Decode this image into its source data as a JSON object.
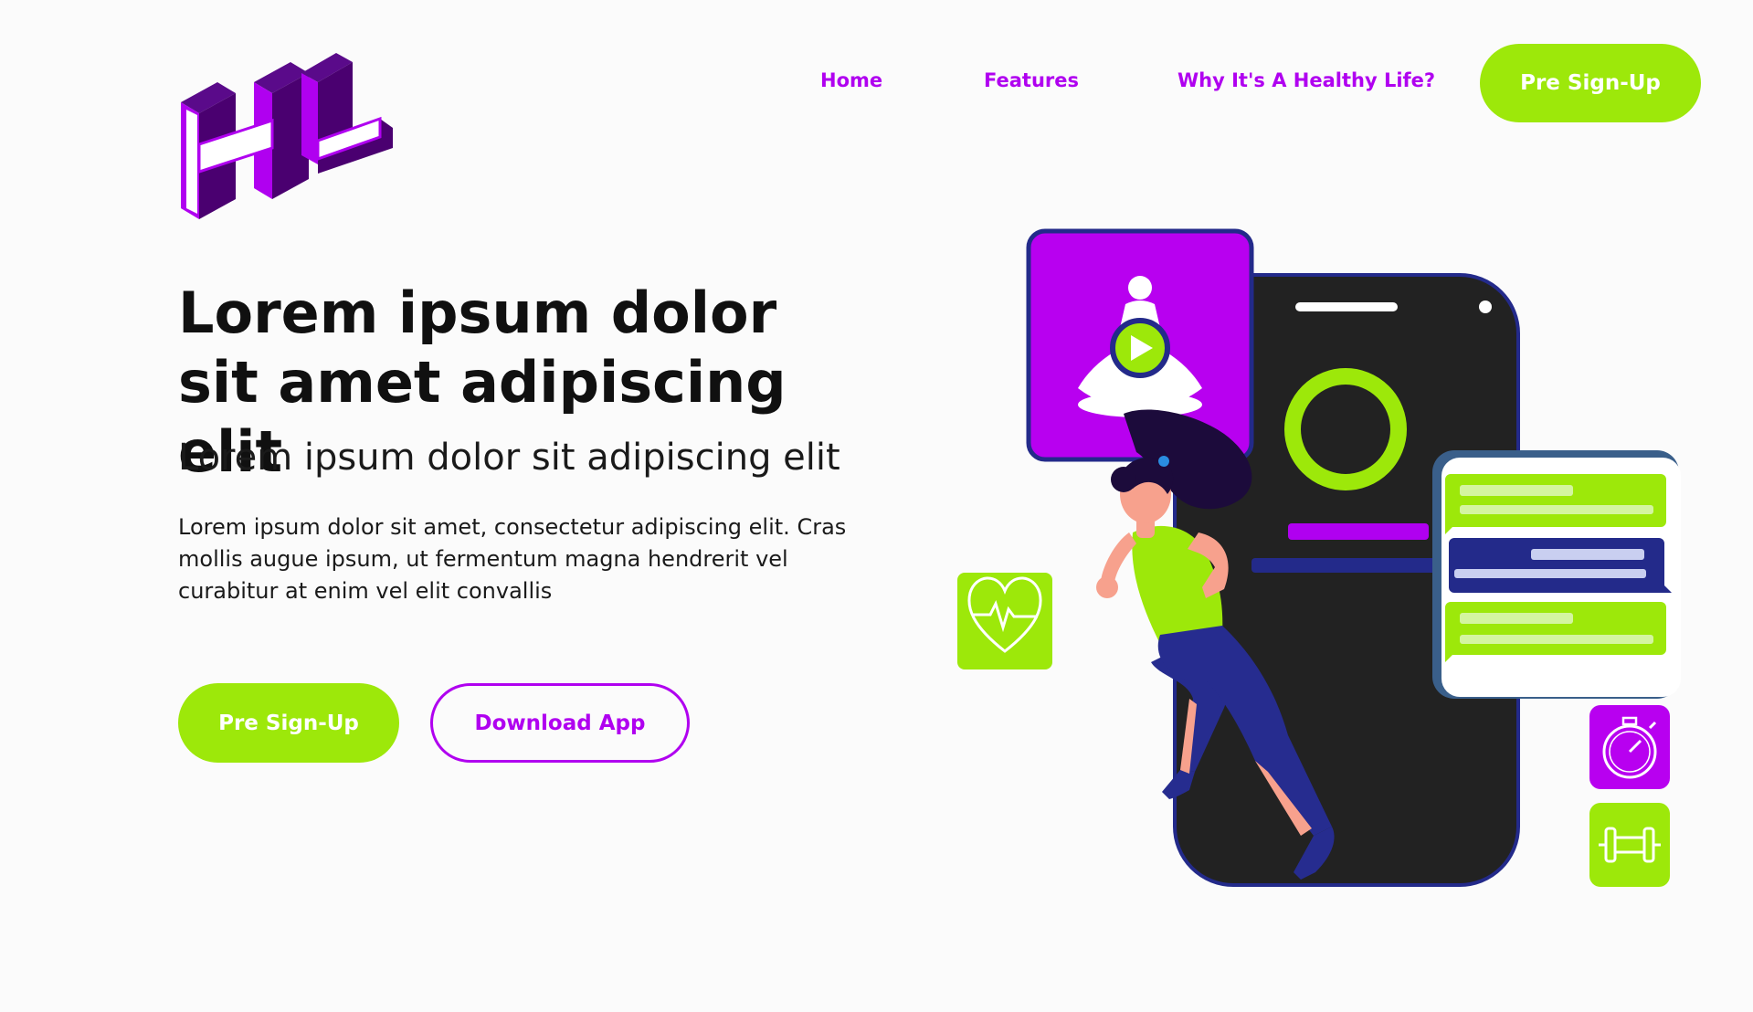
{
  "brand": {
    "logo_letters": "HL",
    "primary_color": "#b000f0",
    "accent_color": "#9de80a",
    "dark_color": "#222222",
    "navy_color": "#232a8a"
  },
  "nav": {
    "items": [
      {
        "label": "Home"
      },
      {
        "label": "Features"
      },
      {
        "label": "Why It's A Healthy Life?"
      }
    ],
    "cta_label": "Pre Sign-Up"
  },
  "hero": {
    "title": "Lorem ipsum dolor sit amet adipiscing elit",
    "subtitle": "Lorem ipsum dolor sit adipiscing elit",
    "body": "Lorem ipsum dolor sit amet, consectetur adipiscing elit. Cras mollis augue ipsum, ut fermentum magna hendrerit vel curabitur at enim vel elit convallis",
    "primary_button": "Pre Sign-Up",
    "secondary_button": "Download App"
  },
  "illustration": {
    "icons": [
      "meditation-play-icon",
      "heart-pulse-icon",
      "stopwatch-icon",
      "dumbbell-icon",
      "progress-ring-icon",
      "chat-bubbles-icon"
    ]
  }
}
